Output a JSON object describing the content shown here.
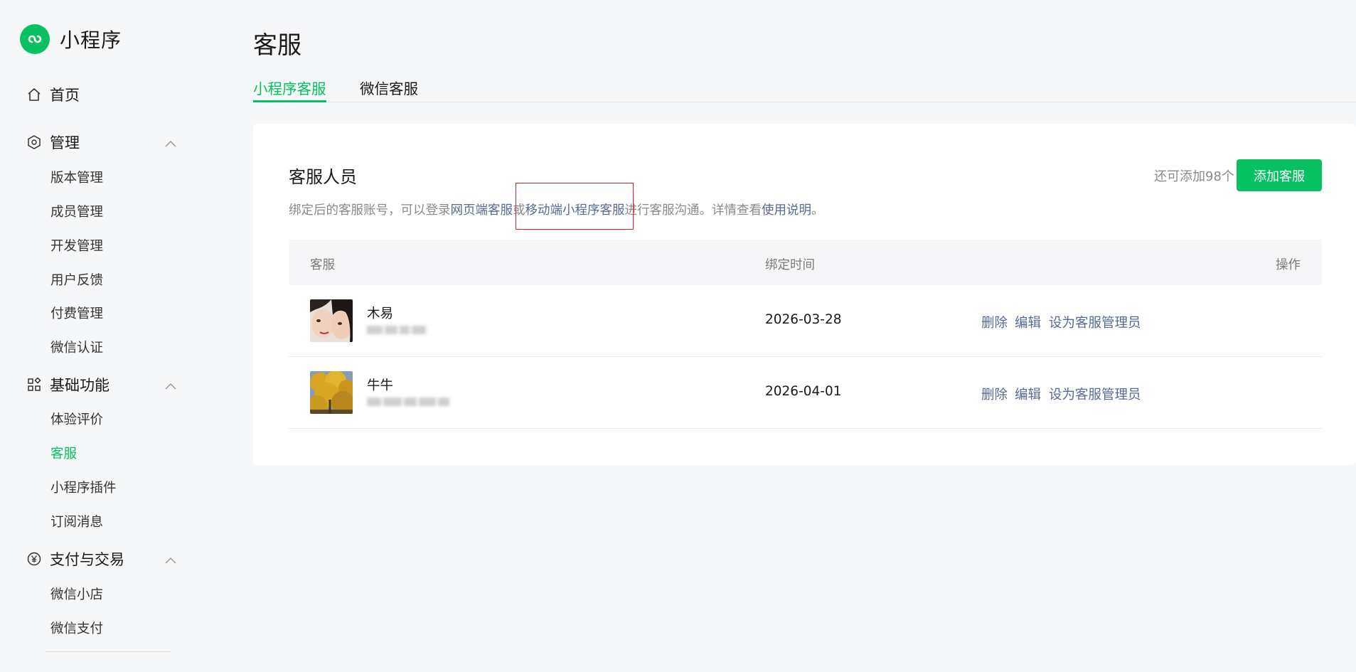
{
  "colors": {
    "brand": "#07c160",
    "link": "#576b95",
    "highlight": "#e02020"
  },
  "sidebar": {
    "brand": {
      "name": "小程序",
      "icon": "mini-program-logo-icon"
    },
    "home": {
      "label": "首页",
      "icon": "home-icon"
    },
    "groups": [
      {
        "label": "管理",
        "icon": "settings-hexagon-icon",
        "expanded": true,
        "items": [
          "版本管理",
          "成员管理",
          "开发管理",
          "用户反馈",
          "付费管理",
          "微信认证"
        ]
      },
      {
        "label": "基础功能",
        "icon": "grid-apps-icon",
        "expanded": true,
        "items": [
          "体验评价",
          "客服",
          "小程序插件",
          "订阅消息"
        ]
      },
      {
        "label": "支付与交易",
        "icon": "yuan-icon",
        "expanded": true,
        "items": [
          "微信小店",
          "微信支付"
        ]
      }
    ],
    "active_item": "客服"
  },
  "page": {
    "title": "客服",
    "tabs": [
      {
        "label": "小程序客服",
        "active": true
      },
      {
        "label": "微信客服",
        "active": false
      }
    ]
  },
  "panel": {
    "title": "客服人员",
    "desc_prefix": "绑定后的客服账号，可以登录",
    "link_web": "网页端客服",
    "desc_or": "或",
    "link_mobile": "移动端小程序客服",
    "desc_mid": "进行客服沟通。详情查看",
    "link_help": "使用说明",
    "desc_end": "。",
    "remaining": "还可添加98个",
    "add_button": "添加客服"
  },
  "table": {
    "headers": {
      "agent": "客服",
      "bind_time": "绑定时间",
      "actions": "操作"
    },
    "rows": [
      {
        "name": "木易",
        "date": "2026-03-28",
        "avatar": "couple-selfie-photo",
        "actions": [
          "删除",
          "编辑",
          "设为客服管理员"
        ]
      },
      {
        "name": "牛牛",
        "date": "2026-04-01",
        "avatar": "yellow-autumn-tree-photo",
        "actions": [
          "删除",
          "编辑",
          "设为客服管理员"
        ]
      }
    ]
  }
}
